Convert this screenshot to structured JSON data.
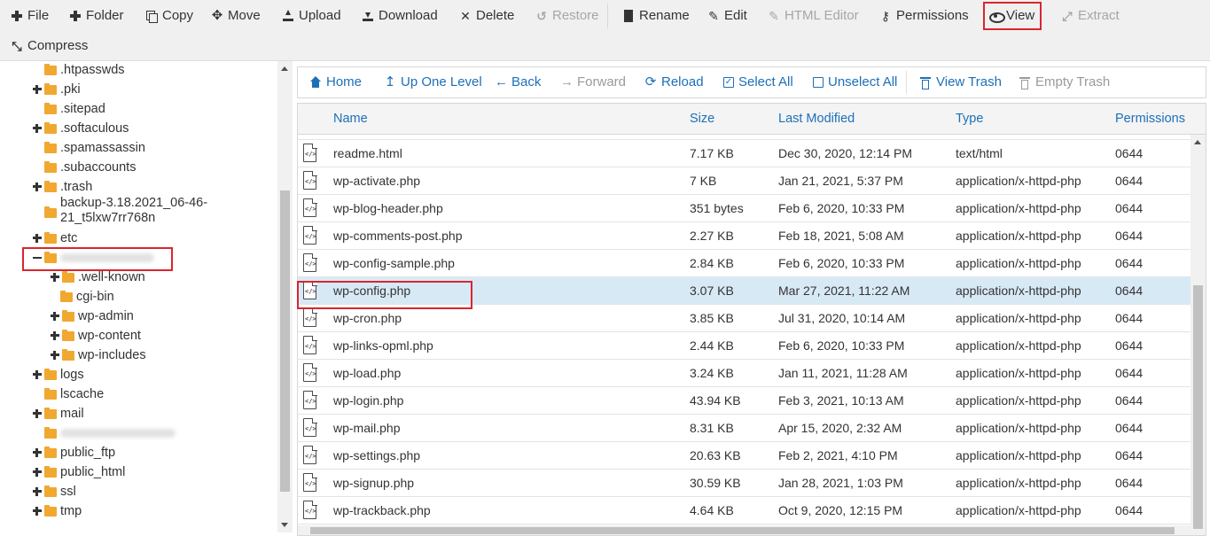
{
  "toolbar": {
    "file": "File",
    "folder": "Folder",
    "copy": "Copy",
    "move": "Move",
    "upload": "Upload",
    "download": "Download",
    "delete": "Delete",
    "restore": "Restore",
    "rename": "Rename",
    "edit": "Edit",
    "html_editor": "HTML Editor",
    "permissions": "Permissions",
    "view": "View",
    "extract": "Extract",
    "compress": "Compress"
  },
  "tree": {
    "items": [
      {
        "label": ".htpasswds"
      },
      {
        "label": ".pki"
      },
      {
        "label": ".sitepad"
      },
      {
        "label": ".softaculous"
      },
      {
        "label": ".spamassassin"
      },
      {
        "label": ".subaccounts"
      },
      {
        "label": ".trash"
      },
      {
        "label": "backup-3.18.2021_06-46-",
        "label2": "21_t5lxw7rr768n"
      },
      {
        "label": "etc"
      },
      {
        "label": ".well-known"
      },
      {
        "label": "cgi-bin"
      },
      {
        "label": "wp-admin"
      },
      {
        "label": "wp-content"
      },
      {
        "label": "wp-includes"
      },
      {
        "label": "logs"
      },
      {
        "label": "lscache"
      },
      {
        "label": "mail"
      },
      {
        "label": "public_ftp"
      },
      {
        "label": "public_html"
      },
      {
        "label": "ssl"
      },
      {
        "label": "tmp"
      }
    ]
  },
  "nav": {
    "home": "Home",
    "up_one_level": "Up One Level",
    "back": "Back",
    "forward": "Forward",
    "reload": "Reload",
    "select_all": "Select All",
    "unselect_all": "Unselect All",
    "view_trash": "View Trash",
    "empty_trash": "Empty Trash"
  },
  "table": {
    "headers": {
      "name": "Name",
      "size": "Size",
      "last_modified": "Last Modified",
      "type": "Type",
      "permissions": "Permissions"
    },
    "rows": [
      {
        "name": "readme.html",
        "size": "7.17 KB",
        "modified": "Dec 30, 2020, 12:14 PM",
        "type": "text/html",
        "perms": "0644"
      },
      {
        "name": "wp-activate.php",
        "size": "7 KB",
        "modified": "Jan 21, 2021, 5:37 PM",
        "type": "application/x-httpd-php",
        "perms": "0644"
      },
      {
        "name": "wp-blog-header.php",
        "size": "351 bytes",
        "modified": "Feb 6, 2020, 10:33 PM",
        "type": "application/x-httpd-php",
        "perms": "0644"
      },
      {
        "name": "wp-comments-post.php",
        "size": "2.27 KB",
        "modified": "Feb 18, 2021, 5:08 AM",
        "type": "application/x-httpd-php",
        "perms": "0644"
      },
      {
        "name": "wp-config-sample.php",
        "size": "2.84 KB",
        "modified": "Feb 6, 2020, 10:33 PM",
        "type": "application/x-httpd-php",
        "perms": "0644"
      },
      {
        "name": "wp-config.php",
        "size": "3.07 KB",
        "modified": "Mar 27, 2021, 11:22 AM",
        "type": "application/x-httpd-php",
        "perms": "0644"
      },
      {
        "name": "wp-cron.php",
        "size": "3.85 KB",
        "modified": "Jul 31, 2020, 10:14 AM",
        "type": "application/x-httpd-php",
        "perms": "0644"
      },
      {
        "name": "wp-links-opml.php",
        "size": "2.44 KB",
        "modified": "Feb 6, 2020, 10:33 PM",
        "type": "application/x-httpd-php",
        "perms": "0644"
      },
      {
        "name": "wp-load.php",
        "size": "3.24 KB",
        "modified": "Jan 11, 2021, 11:28 AM",
        "type": "application/x-httpd-php",
        "perms": "0644"
      },
      {
        "name": "wp-login.php",
        "size": "43.94 KB",
        "modified": "Feb 3, 2021, 10:13 AM",
        "type": "application/x-httpd-php",
        "perms": "0644"
      },
      {
        "name": "wp-mail.php",
        "size": "8.31 KB",
        "modified": "Apr 15, 2020, 2:32 AM",
        "type": "application/x-httpd-php",
        "perms": "0644"
      },
      {
        "name": "wp-settings.php",
        "size": "20.63 KB",
        "modified": "Feb 2, 2021, 4:10 PM",
        "type": "application/x-httpd-php",
        "perms": "0644"
      },
      {
        "name": "wp-signup.php",
        "size": "30.59 KB",
        "modified": "Jan 28, 2021, 1:03 PM",
        "type": "application/x-httpd-php",
        "perms": "0644"
      },
      {
        "name": "wp-trackback.php",
        "size": "4.64 KB",
        "modified": "Oct 9, 2020, 12:15 PM",
        "type": "application/x-httpd-php",
        "perms": "0644"
      }
    ]
  },
  "icons": {
    "file": "php-file-icon",
    "folder": "folder-icon"
  },
  "colors": {
    "link_blue": "#1d6fb8",
    "folder": "#f0a830",
    "highlight_red": "#d9262d",
    "selected_row": "#d8e9f6"
  }
}
